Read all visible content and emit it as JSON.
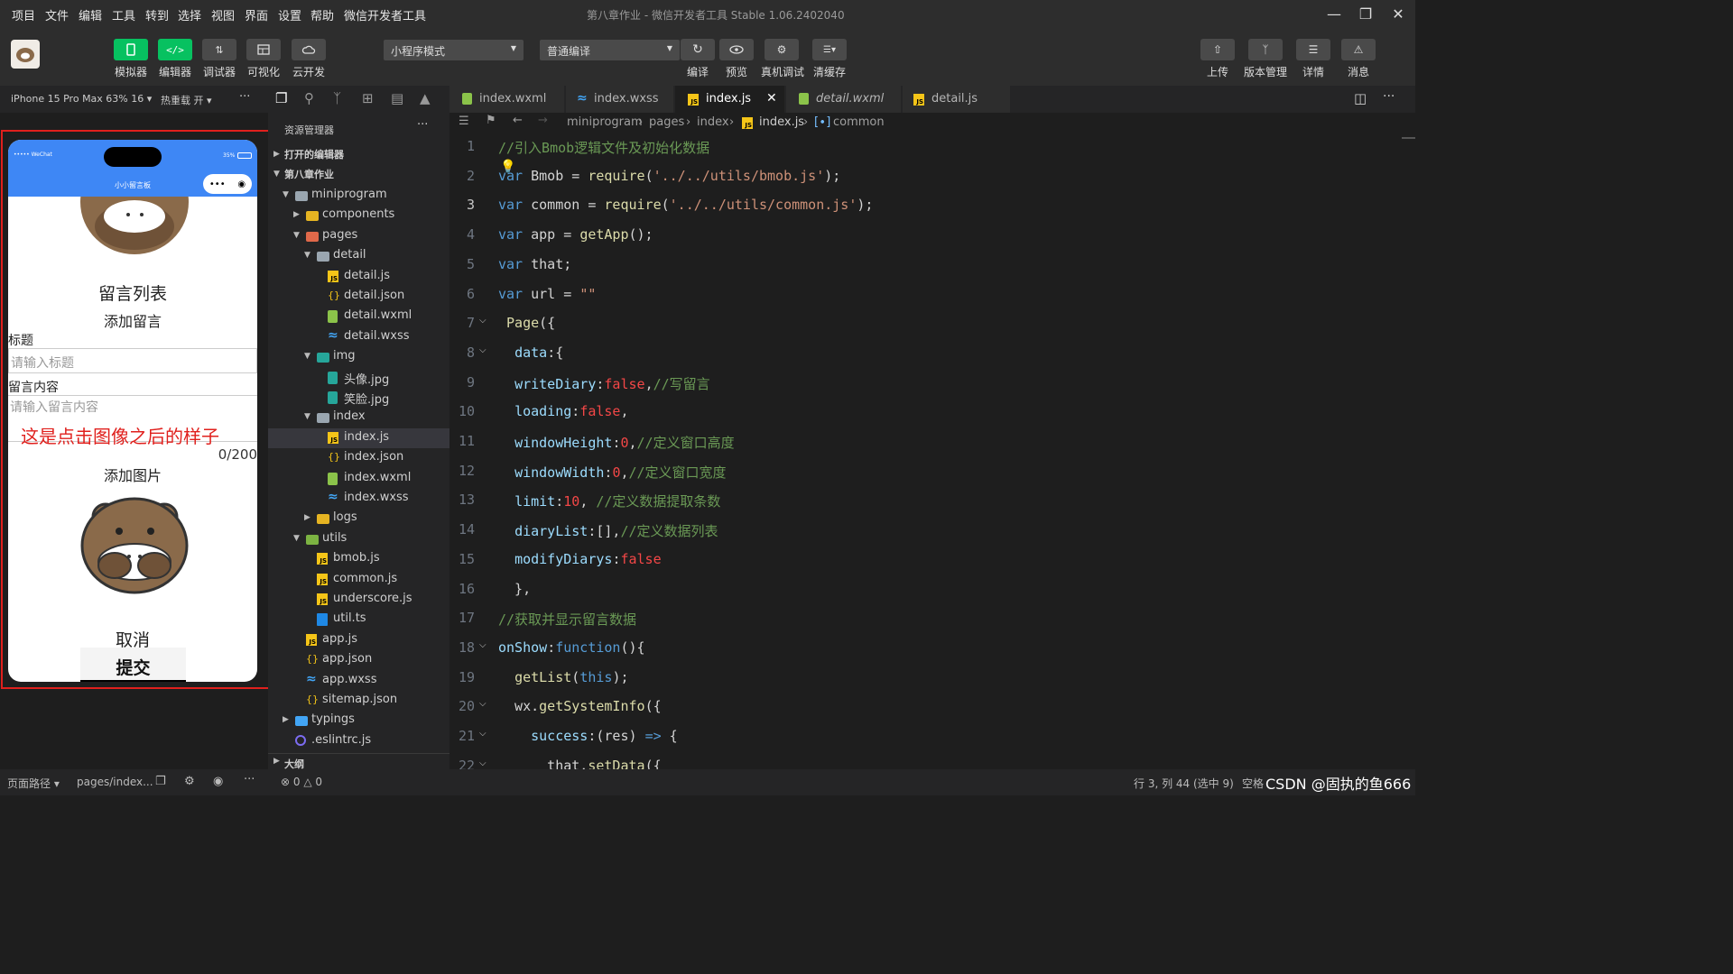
{
  "menu": [
    "项目",
    "文件",
    "编辑",
    "工具",
    "转到",
    "选择",
    "视图",
    "界面",
    "设置",
    "帮助",
    "微信开发者工具"
  ],
  "window_title": "第八章作业 - 微信开发者工具 Stable 1.06.2402040",
  "toolbar": {
    "left_buttons": [
      "模拟器",
      "编辑器",
      "调试器",
      "可视化",
      "云开发"
    ],
    "mode_select": "小程序模式",
    "compile_select": "普通编译",
    "mid_buttons": [
      "编译",
      "预览",
      "真机调试",
      "清缓存"
    ],
    "right_buttons": [
      "上传",
      "版本管理",
      "详情",
      "消息"
    ]
  },
  "simulator": {
    "device": "iPhone 15 Pro Max 63% 16",
    "hot_reload": "热重载 开",
    "status_signal": "••••• WeChat",
    "status_battery": "35%",
    "nav_title": "小小留言板",
    "page": {
      "list_title": "留言列表",
      "add_title": "添加留言",
      "title_label": "标题",
      "title_placeholder": "请输入标题",
      "content_label": "留言内容",
      "content_placeholder": "请输入留言内容",
      "annotation": "这是点击图像之后的样子",
      "counter": "0/200",
      "add_image": "添加图片",
      "cancel": "取消",
      "submit": "提交"
    }
  },
  "explorer": {
    "header": "资源管理器",
    "sections": [
      "打开的编辑器",
      "第八章作业"
    ],
    "tree": [
      {
        "label": "miniprogram",
        "icon": "folder",
        "depth": 1,
        "open": true
      },
      {
        "label": "components",
        "icon": "folder-yellow",
        "depth": 2,
        "open": false
      },
      {
        "label": "pages",
        "icon": "folder-red",
        "depth": 2,
        "open": true
      },
      {
        "label": "detail",
        "icon": "folder",
        "depth": 3,
        "open": true
      },
      {
        "label": "detail.js",
        "icon": "js",
        "depth": 4
      },
      {
        "label": "detail.json",
        "icon": "json",
        "depth": 4
      },
      {
        "label": "detail.wxml",
        "icon": "wxml",
        "depth": 4
      },
      {
        "label": "detail.wxss",
        "icon": "wxss",
        "depth": 4
      },
      {
        "label": "img",
        "icon": "folder-teal",
        "depth": 3,
        "open": true
      },
      {
        "label": "头像.jpg",
        "icon": "img",
        "depth": 4
      },
      {
        "label": "笑脸.jpg",
        "icon": "img",
        "depth": 4
      },
      {
        "label": "index",
        "icon": "folder",
        "depth": 3,
        "open": true
      },
      {
        "label": "index.js",
        "icon": "js",
        "depth": 4,
        "selected": true
      },
      {
        "label": "index.json",
        "icon": "json",
        "depth": 4
      },
      {
        "label": "index.wxml",
        "icon": "wxml",
        "depth": 4
      },
      {
        "label": "index.wxss",
        "icon": "wxss",
        "depth": 4
      },
      {
        "label": "logs",
        "icon": "folder-yellow",
        "depth": 3,
        "open": false
      },
      {
        "label": "utils",
        "icon": "folder-green",
        "depth": 2,
        "open": true
      },
      {
        "label": "bmob.js",
        "icon": "js",
        "depth": 3
      },
      {
        "label": "common.js",
        "icon": "js",
        "depth": 3
      },
      {
        "label": "underscore.js",
        "icon": "js",
        "depth": 3
      },
      {
        "label": "util.ts",
        "icon": "ts",
        "depth": 3
      },
      {
        "label": "app.js",
        "icon": "js",
        "depth": 2
      },
      {
        "label": "app.json",
        "icon": "json",
        "depth": 2
      },
      {
        "label": "app.wxss",
        "icon": "wxss",
        "depth": 2
      },
      {
        "label": "sitemap.json",
        "icon": "json",
        "depth": 2
      },
      {
        "label": "typings",
        "icon": "folder-blue",
        "depth": 1,
        "open": false
      },
      {
        "label": ".eslintrc.js",
        "icon": "eslint",
        "depth": 1
      }
    ],
    "outline": "大纲"
  },
  "tabs": [
    {
      "label": "index.wxml",
      "icon": "wxml"
    },
    {
      "label": "index.wxss",
      "icon": "wxss"
    },
    {
      "label": "index.js",
      "icon": "js",
      "active": true
    },
    {
      "label": "detail.wxml",
      "icon": "wxml",
      "italic": true
    },
    {
      "label": "detail.js",
      "icon": "js"
    }
  ],
  "breadcrumb": [
    "miniprogram",
    "pages",
    "index",
    "index.js",
    "common"
  ],
  "code_lines": [
    "//引入Bmob逻辑文件及初始化数据",
    "var Bmob = require('../../utils/bmob.js');",
    "var common = require('../../utils/common.js');",
    "var app = getApp();",
    "var that;",
    "var url = \"\"",
    " Page({",
    "  data:{",
    "  writeDiary:false,//写留言",
    "  loading:false,",
    "  windowHeight:0,//定义窗口高度",
    "  windowWidth:0,//定义窗口宽度",
    "  limit:10, //定义数据提取条数",
    "  diaryList:[],//定义数据列表",
    "  modifyDiarys:false",
    "  },",
    "//获取并显示留言数据",
    "onShow:function(){",
    "  getList(this);",
    "  wx.getSystemInfo({",
    "    success:(res) => {",
    "      that.setData({"
  ],
  "status": {
    "page_path_label": "页面路径",
    "page_path": "pages/index...",
    "errors": "0",
    "warnings": "0",
    "cursor": "行 3, 列 44 (选中 9)",
    "right_text": "空格",
    "watermark": "CSDN @固执的鱼666"
  }
}
